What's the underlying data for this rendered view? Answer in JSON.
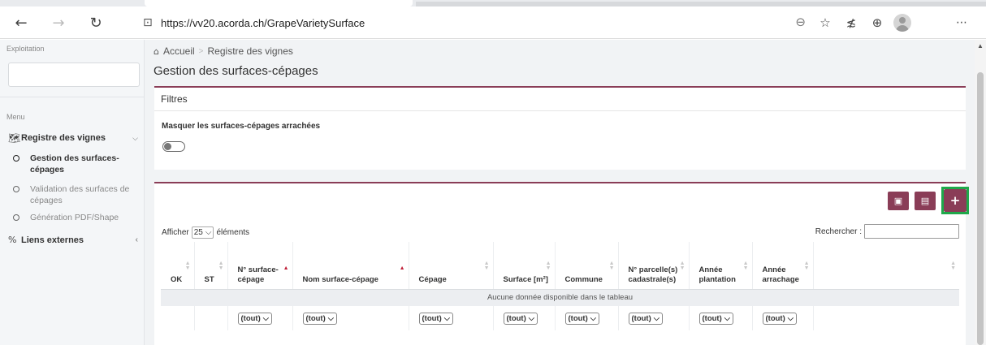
{
  "browser": {
    "url": "https://vv20.acorda.ch/GrapeVarietySurface",
    "icons": [
      "back-arrow-icon",
      "forward-arrow-icon",
      "refresh-icon",
      "lock-icon",
      "zoom-icon",
      "favorite-add-icon",
      "favorites-icon",
      "collections-icon",
      "profile-avatar",
      "more-icon"
    ]
  },
  "sidebar": {
    "exploitation_label": "Exploitation",
    "menu_label": "Menu",
    "group": {
      "label": "Registre des vignes"
    },
    "items": [
      {
        "label": "Gestion des surfaces-cépages",
        "active": true
      },
      {
        "label": "Validation des surfaces de cépages",
        "active": false
      },
      {
        "label": "Génération PDF/Shape",
        "active": false
      }
    ],
    "external_links": "Liens externes"
  },
  "breadcrumb": {
    "home": "Accueil",
    "current": "Registre des vignes"
  },
  "page_title": "Gestion des surfaces-cépages",
  "filters": {
    "title": "Filtres",
    "toggle_label": "Masquer les surfaces-cépages arrachées",
    "toggle_on": false
  },
  "table": {
    "show_prefix": "Afficher",
    "page_size": "25",
    "show_suffix": "éléments",
    "search_label": "Rechercher :",
    "columns": [
      "OK",
      "ST",
      "N° surface-cépage",
      "Nom surface-cépage",
      "Cépage",
      "Surface [m²]",
      "Commune",
      "N° parcelle(s) cadastrale(s)",
      "Année plantation",
      "Année arrachage",
      ""
    ],
    "empty_message": "Aucune donnée disponible dans le tableau",
    "filter_value": "(tout)"
  },
  "colors": {
    "accent": "#8a3d57",
    "highlight": "#1fa84a"
  }
}
